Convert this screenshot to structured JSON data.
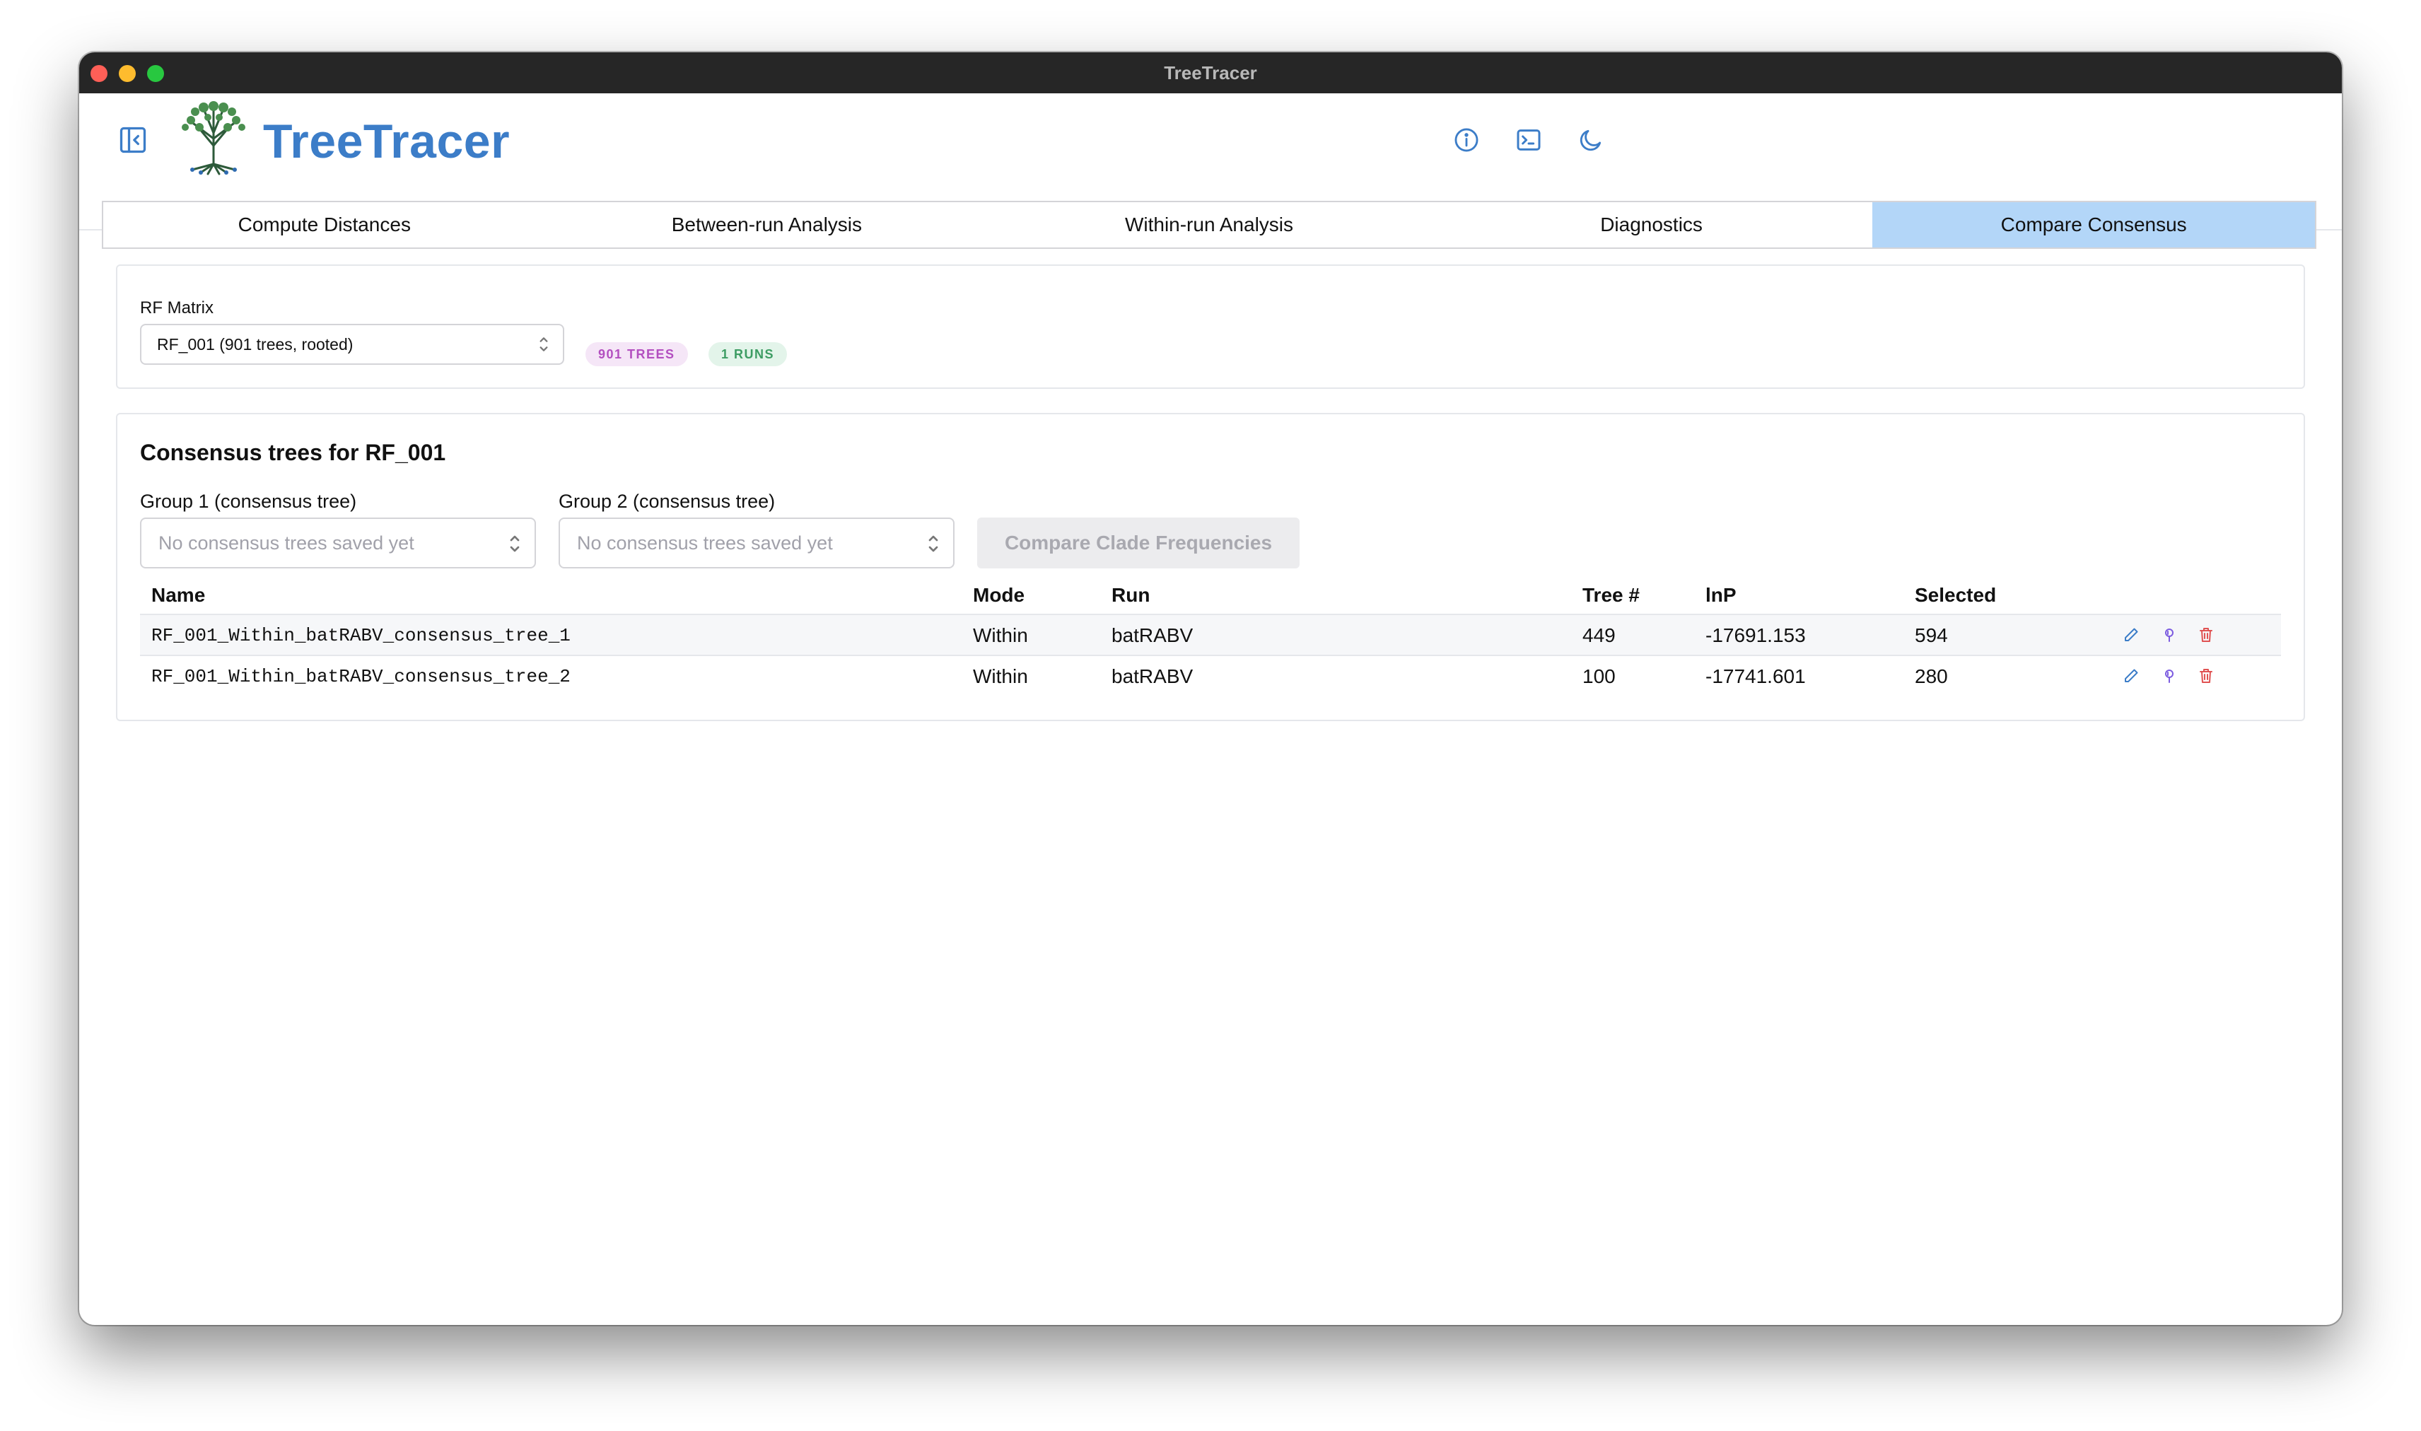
{
  "window": {
    "title": "TreeTracer"
  },
  "header": {
    "app_name": "TreeTracer",
    "left_icon": "sidebar-toggle-icon",
    "right_icons": [
      "info-icon",
      "terminal-icon",
      "moon-icon"
    ]
  },
  "tabs": [
    {
      "label": "Compute Distances",
      "active": false
    },
    {
      "label": "Between-run Analysis",
      "active": false
    },
    {
      "label": "Within-run Analysis",
      "active": false
    },
    {
      "label": "Diagnostics",
      "active": false
    },
    {
      "label": "Compare Consensus",
      "active": true
    }
  ],
  "rf_panel": {
    "label": "RF Matrix",
    "selected": "RF_001 (901 trees, rooted)",
    "trees_badge": "901 TREES",
    "runs_badge": "1 RUNS"
  },
  "consensus": {
    "title": "Consensus trees for RF_001",
    "group1_label": "Group 1 (consensus tree)",
    "group1_placeholder": "No consensus trees saved yet",
    "group2_label": "Group 2 (consensus tree)",
    "group2_placeholder": "No consensus trees saved yet",
    "compare_button": "Compare Clade Frequencies",
    "columns": [
      "Name",
      "Mode",
      "Run",
      "Tree #",
      "lnP",
      "Selected"
    ],
    "rows": [
      {
        "name": "RF_001_Within_batRABV_consensus_tree_1",
        "mode": "Within",
        "run": "batRABV",
        "tree": "449",
        "lnp": "-17691.153",
        "selected": "594"
      },
      {
        "name": "RF_001_Within_batRABV_consensus_tree_2",
        "mode": "Within",
        "run": "batRABV",
        "tree": "100",
        "lnp": "-17741.601",
        "selected": "280"
      }
    ],
    "row_actions": [
      "edit-icon",
      "pin-icon",
      "trash-icon"
    ]
  },
  "colors": {
    "brand": "#3c7dc8",
    "active_tab": "#b3d6f8",
    "trees_badge_text": "#b34fc0",
    "runs_badge_text": "#3d9c63",
    "delete": "#e05252",
    "pin": "#7c5ce0"
  }
}
